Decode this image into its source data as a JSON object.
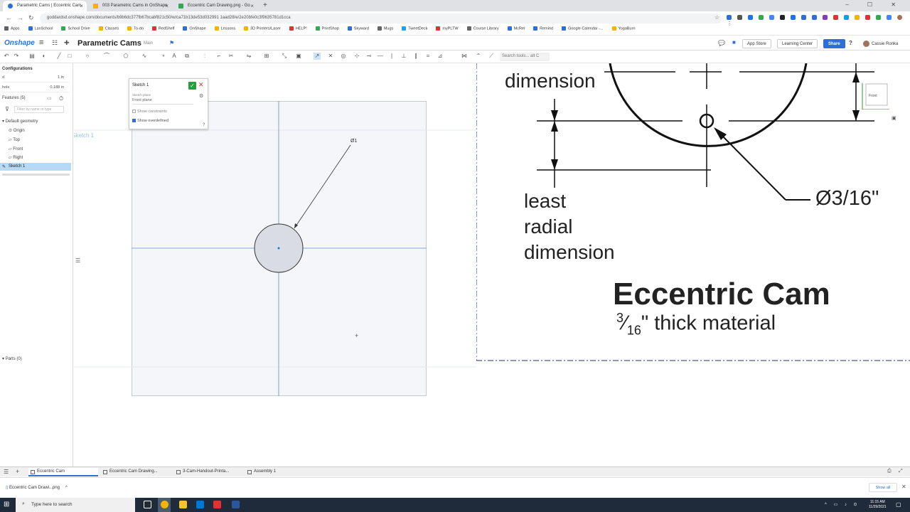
{
  "browser": {
    "tabs": [
      {
        "title": "Parametric Cams | Eccentric Cam",
        "active": true,
        "icon_color": "#2d6fd6"
      },
      {
        "title": "003 Parametric Cams in OnShape",
        "active": false,
        "icon_color": "#f4b400"
      },
      {
        "title": "Eccentric Cam Drawing.png - Go",
        "active": false,
        "icon_color": "#34a853"
      }
    ],
    "new_tab": "+",
    "window_controls": "– ☐ ✕",
    "url": "goddardsd.onshape.com/documents/b9b6dc377fb67bcabf821c50/w/ca71b13de53d032991 1aad28/e/2e20bfe0c3f9635781d1cca"
  },
  "bookmarks": [
    {
      "label": "Apps",
      "color": "#5f6368"
    },
    {
      "label": "LanSchool",
      "color": "#2d6fd6"
    },
    {
      "label": "School Drive",
      "color": "#34a853"
    },
    {
      "label": "Classes",
      "color": "#f4b400"
    },
    {
      "label": "To-do",
      "color": "#f4b400"
    },
    {
      "label": "RedShelf",
      "color": "#d33"
    },
    {
      "label": "OnShape",
      "color": "#2d6fd6"
    },
    {
      "label": "Lessons",
      "color": "#f4b400"
    },
    {
      "label": "3D Printers/Laser",
      "color": "#f4b400"
    },
    {
      "label": "HELP!",
      "color": "#d33"
    },
    {
      "label": "PrintShop",
      "color": "#34a853"
    },
    {
      "label": "Skyward",
      "color": "#2d6fd6"
    },
    {
      "label": "Mugs",
      "color": "#666"
    },
    {
      "label": "TweetDeck",
      "color": "#1da1f2"
    },
    {
      "label": "myPLTW",
      "color": "#d33"
    },
    {
      "label": "Course Library",
      "color": "#666"
    },
    {
      "label": "McRel",
      "color": "#2d6fd6"
    },
    {
      "label": "Remind",
      "color": "#2d6fd6"
    },
    {
      "label": "Google Calendar -...",
      "color": "#2d6fd6"
    },
    {
      "label": "YogaBurn",
      "color": "#f4b400"
    }
  ],
  "header": {
    "logo": "Onshape",
    "document_title": "Parametric Cams",
    "branch": "Main",
    "app_store": "App Store",
    "learning_center": "Learning Center",
    "share": "Share",
    "help": "?",
    "user_name": "Cassie Ronka"
  },
  "toolbar": {
    "search_placeholder": "Search tools... alt C"
  },
  "left_panel": {
    "configurations": "Configurations",
    "config_rows": [
      {
        "name": "d",
        "value": "1 in"
      },
      {
        "name": "hole",
        "value": "0.188 in"
      }
    ],
    "features": "Features (5)",
    "filter_placeholder": "Filter by name or type",
    "default_geometry": "Default geometry",
    "tree_items": [
      "Origin",
      "Top",
      "Front",
      "Right"
    ],
    "selected_item": "Sketch 1",
    "parts": "Parts (0)"
  },
  "sketch_dialog": {
    "title": "Sketch 1",
    "plane_label": "Sketch plane",
    "plane_value": "Front plane",
    "show_constraints": "Show constraints",
    "show_overdefined": "Show overdefined"
  },
  "canvas": {
    "sketch_label": "Sketch 1",
    "dimension_label": "Ø1",
    "view_cube": "Front"
  },
  "drawing_image": {
    "dimension_top": "dimension",
    "least_1": "least",
    "least_2": "radial",
    "least_3": "dimension",
    "hole_callout": "Ø3/16\"",
    "title": "Eccentric Cam",
    "fraction_num": "3",
    "fraction_den": "16",
    "subtitle": "\" thick material"
  },
  "bottom_tabs": [
    {
      "label": "Eccentric Cam",
      "active": true
    },
    {
      "label": "Eccentric Cam Drawing...",
      "active": false
    },
    {
      "label": "3-Cam-Handout-Printa...",
      "active": false
    },
    {
      "label": "Assembly 1",
      "active": false
    }
  ],
  "download_bar": {
    "file": "Eccentric Cam Drawi...png",
    "show_all": "Show all"
  },
  "taskbar": {
    "search": "Type here to search",
    "time": "11:15 AM",
    "date": "11/29/2021"
  }
}
